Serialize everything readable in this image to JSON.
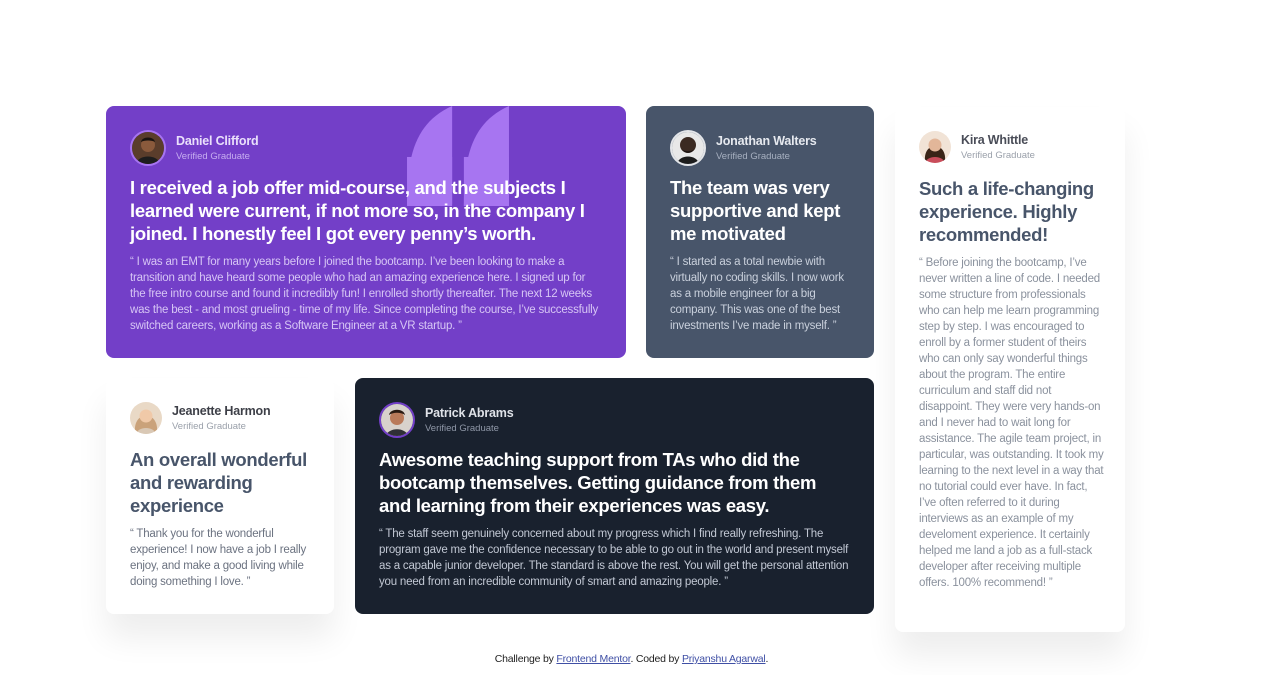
{
  "testimonials": [
    {
      "name": "Daniel Clifford",
      "role": "Verified Graduate",
      "headline": "I received a job offer mid-course, and the subjects I learned were current, if not more so, in the company I joined. I honestly feel I got every penny’s worth.",
      "quote": "“ I was an EMT for many years before I joined the bootcamp. I’ve been looking to make a transition and have heard some people who had an amazing experience here. I signed up for the free intro course and found it incredibly fun! I enrolled shortly thereafter. The next 12 weeks was the best - and most grueling - time of my life. Since completing the course, I’ve successfully switched careers, working as a Software Engineer at a VR startup. ”",
      "avatar_icon": "avatar-daniel"
    },
    {
      "name": "Jonathan Walters",
      "role": "Verified Graduate",
      "headline": "The team was very supportive and kept me motivated",
      "quote": "“ I started as a total newbie with virtually no coding skills. I now work as a mobile engineer for a big company. This was one of the best investments I’ve made in myself. ”",
      "avatar_icon": "avatar-jonathan"
    },
    {
      "name": "Jeanette Harmon",
      "role": "Verified Graduate",
      "headline": "An overall wonderful and rewarding experience",
      "quote": "“ Thank you for the wonderful experience! I now have a job I really enjoy, and make a good living while doing something I love. ”",
      "avatar_icon": "avatar-jeanette"
    },
    {
      "name": "Patrick Abrams",
      "role": "Verified Graduate",
      "headline": "Awesome teaching support from TAs who did the bootcamp themselves. Getting guidance from them and learning from their experiences was easy.",
      "quote": "“ The staff seem genuinely concerned about my progress which I find really refreshing. The program gave me the confidence necessary to be able to go out in the world and present myself as a capable junior developer. The standard is above the rest. You will get the personal attention you need from an incredible community of smart and amazing people. ”",
      "avatar_icon": "avatar-patrick"
    },
    {
      "name": "Kira Whittle",
      "role": "Verified Graduate",
      "headline": "Such a life-changing experience. Highly recommended!",
      "quote": "“ Before joining the bootcamp, I’ve never written a line of code. I needed some structure from professionals who can help me learn programming step by step. I was encouraged to enroll by a former student of theirs who can only say wonderful things about the program. The entire curriculum and staff did not disappoint. They were very hands-on and I never had to wait long for assistance. The agile team project, in particular, was outstanding. It took my learning to the next level in a way that no tutorial could ever have. In fact, I’ve often referred to it during interviews as an example of my develoment experience. It certainly helped me land a job as a full-stack developer after receiving multiple offers. 100% recommend! ”",
      "avatar_icon": "avatar-kira"
    }
  ],
  "decoration": {
    "quote_icon": "quotation-mark-icon"
  },
  "footer": {
    "prefix": "Challenge by ",
    "link1": "Frontend Mentor",
    "middle": ". Coded by ",
    "link2": "Priyanshu Agarwal",
    "suffix": "."
  },
  "colors": {
    "purple": "#733fc8",
    "slate": "#48556a",
    "dark": "#19212e",
    "white": "#ffffff",
    "quote_accent": "#a775f1"
  }
}
